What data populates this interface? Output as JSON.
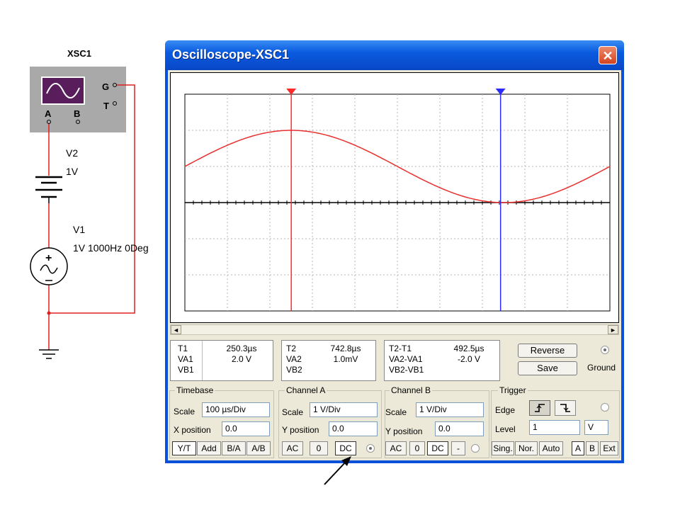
{
  "schematic": {
    "instrument_label": "XSC1",
    "pin_g": "G",
    "pin_t": "T",
    "pin_a": "A",
    "pin_b": "B",
    "v2_name": "V2",
    "v2_value": "1V",
    "v1_name": "V1",
    "v1_value": "1V 1000Hz 0Deg",
    "wire_color": "#e02020"
  },
  "window": {
    "title": "Oscilloscope-XSC1",
    "close_glyph": "✕"
  },
  "display": {
    "trace_color": "#e8302e",
    "cursor1_color": "#ff2a2a",
    "cursor2_color": "#2b2bff",
    "scroll_left": "◄",
    "scroll_right": "►"
  },
  "readout": {
    "t1": {
      "label": "T1",
      "value": "250.3µs",
      "va_label": "VA1",
      "va_value": "2.0 V",
      "vb_label": "VB1",
      "vb_value": ""
    },
    "t2": {
      "label": "T2",
      "value": "742.8µs",
      "va_label": "VA2",
      "va_value": "1.0mV",
      "vb_label": "VB2",
      "vb_value": ""
    },
    "diff": {
      "label": "T2-T1",
      "value": "492.5µs",
      "va_label": "VA2-VA1",
      "va_value": "-2.0 V",
      "vb_label": "VB2-VB1",
      "vb_value": ""
    },
    "reverse_label": "Reverse",
    "save_label": "Save",
    "ground_label": "Ground"
  },
  "timebase": {
    "title": "Timebase",
    "scale_label": "Scale",
    "scale_value": "100 µs/Div",
    "xpos_label": "X position",
    "xpos_value": "0.0",
    "buttons": [
      "Y/T",
      "Add",
      "B/A",
      "A/B"
    ],
    "selected": "Y/T"
  },
  "channel_a": {
    "title": "Channel A",
    "scale_label": "Scale",
    "scale_value": "1 V/Div",
    "ypos_label": "Y position",
    "ypos_value": "0.0",
    "buttons": [
      "AC",
      "0",
      "DC"
    ],
    "selected": "DC"
  },
  "channel_b": {
    "title": "Channel B",
    "scale_label": "Scale",
    "scale_value": "1 V/Div",
    "ypos_label": "Y position",
    "ypos_value": "0.0",
    "buttons": [
      "AC",
      "0",
      "DC",
      "-"
    ],
    "selected": "DC"
  },
  "trigger": {
    "title": "Trigger",
    "edge_label": "Edge",
    "level_label": "Level",
    "level_value": "1",
    "level_unit": "V",
    "mode_buttons": [
      "Sing.",
      "Nor.",
      "Auto"
    ],
    "source_buttons": [
      "A",
      "B",
      "Ext"
    ],
    "selected_source": "A"
  }
}
